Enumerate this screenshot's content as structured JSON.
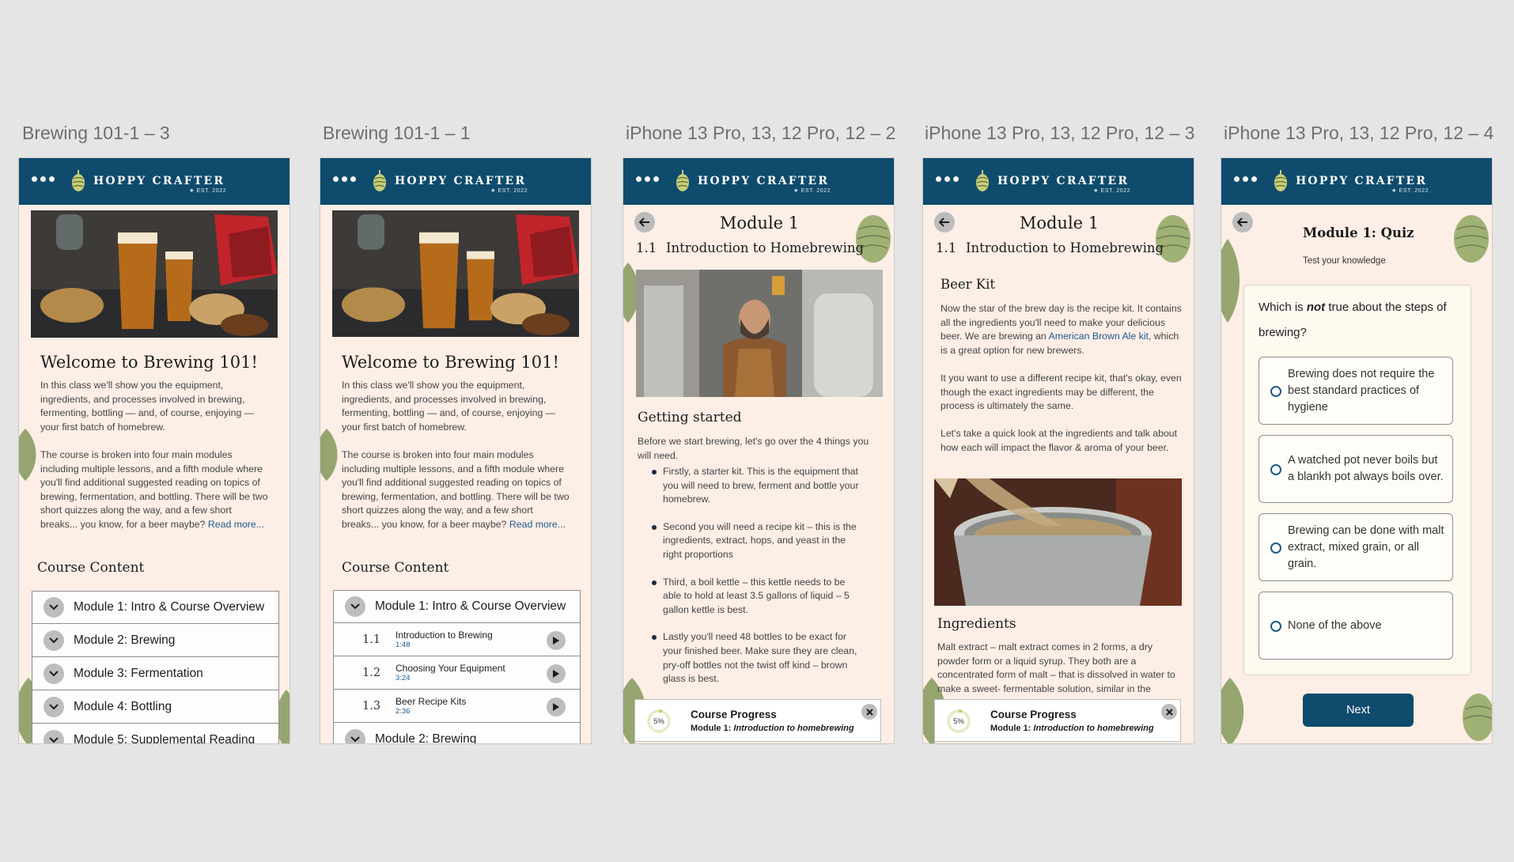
{
  "frames": [
    {
      "title": "Brewing 101-1 – 3"
    },
    {
      "title": "Brewing 101-1 – 1"
    },
    {
      "title": "iPhone 13 Pro, 13, 12 Pro, 12 – 2"
    },
    {
      "title": "iPhone 13 Pro, 13, 12 Pro, 12 – 3"
    },
    {
      "title": "iPhone 13 Pro, 13, 12 Pro, 12 – 4"
    }
  ],
  "brand": {
    "name": "HOPPY CRAFTER",
    "tagline": "★ EST. 2022",
    "colors": {
      "header": "#0e4b6c",
      "page_bg": "#fdeee6",
      "link": "#1c5a8a"
    }
  },
  "welcome": {
    "heading": "Welcome to Brewing 101!",
    "para1": "In this class we'll show you the equipment, ingredients, and processes involved in brewing, fermenting, bottling — and, of course, enjoying — your first batch of homebrew.",
    "para2": "The course is broken into four main modules including multiple lessons, and a fifth module where you'll find additional suggested reading on topics of brewing, fermentation, and bottling. There will be two short quizzes along the way, and a few short breaks... you know, for a beer maybe?",
    "read_more": "Read more...",
    "course_content": "Course Content"
  },
  "modules": [
    {
      "label": "Module 1: Intro & Course Overview"
    },
    {
      "label": "Module 2: Brewing"
    },
    {
      "label": "Module 3: Fermentation"
    },
    {
      "label": "Module 4: Bottling"
    },
    {
      "label": "Module 5: Supplemental Reading"
    }
  ],
  "lessons": [
    {
      "num": "1.1",
      "title": "Introduction to Brewing",
      "duration": "1:48"
    },
    {
      "num": "1.2",
      "title": "Choosing Your Equipment",
      "duration": "3:24"
    },
    {
      "num": "1.3",
      "title": "Beer Recipe Kits",
      "duration": "2:36"
    }
  ],
  "lesson_page": {
    "module_title": "Module 1",
    "lesson_num": "1.1",
    "lesson_title": "Introduction to Homebrewing",
    "getting_started": "Getting started",
    "intro": "Before we start brewing, let's go over the 4 things you will need.",
    "bullets": [
      "Firstly, a starter kit. This is the equipment that you will need to brew, ferment and bottle your homebrew.",
      "Second you will need a recipe kit – this is the ingredients, extract, hops, and yeast in the right proportions",
      "Third, a boil kettle – this kettle needs to be able to hold at least 3.5 gallons of liquid – 5 gallon kettle is best.",
      "Lastly you'll need 48 bottles to be exact for your finished beer. Make sure they are clean, pry-off bottles not the twist off kind – brown glass is best."
    ]
  },
  "beer_kit": {
    "heading": "Beer Kit",
    "para1_a": "Now the star of the brew day is the recipe kit. It contains all the ingredients you'll need to make your delicious beer. We are brewing an",
    "para1_link": "American Brown Ale kit",
    "para1_b": ", which is a great option for new brewers.",
    "para2": "It you want to use a different recipe kit, that's okay, even though the exact ingredients may be different, the process is ultimately the same.",
    "para3": "Let's take a quick look at the ingredients and talk about how each will impact the flavor & aroma of your beer.",
    "ingredients_heading": "Ingredients",
    "ingredients_text": "Malt extract – malt extract comes in 2 forms, a dry powder form or a liquid syrup. They both are a concentrated form of malt – that is dissolved in water to make a sweet- fermentable solution, similar in the"
  },
  "course_progress": {
    "title": "Course Progress",
    "module_prefix": "Module 1:",
    "module_name": "Introduction to homebrewing",
    "percent_label": "5%",
    "percent": 5
  },
  "quiz": {
    "title": "Module 1: Quiz",
    "subtitle": "Test your knowledge",
    "question_a": "Which is",
    "question_em": "not",
    "question_b": "true about the steps of brewing?",
    "options": [
      "Brewing does not require the best standard practices of hygiene",
      "A watched pot never boils but a blankh pot always boils over.",
      "Brewing can be done with malt extract, mixed grain, or all grain.",
      "None of the above"
    ],
    "next": "Next"
  }
}
